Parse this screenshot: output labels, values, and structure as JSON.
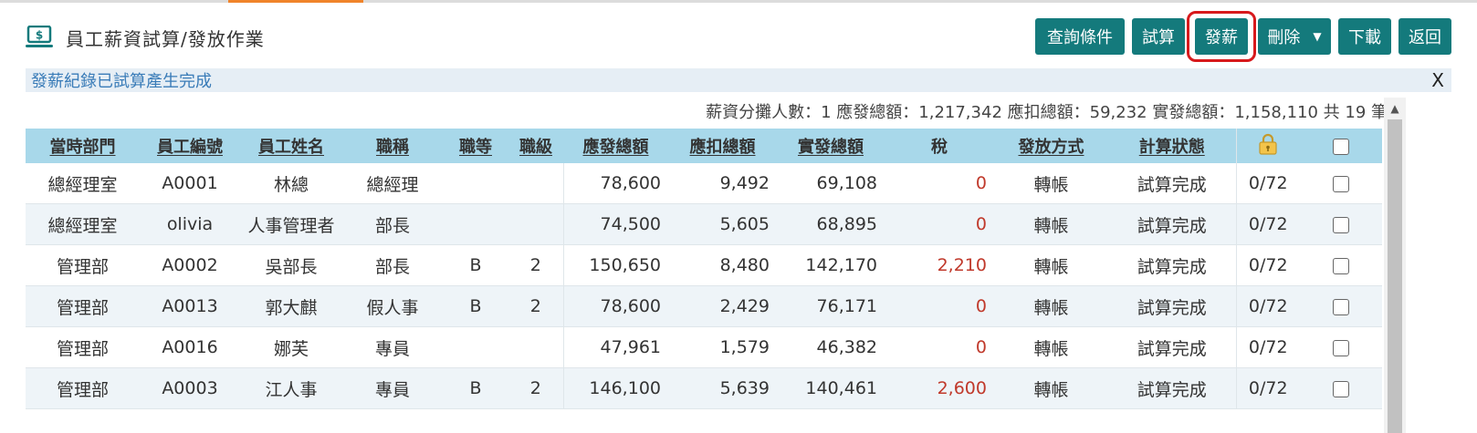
{
  "header": {
    "title": "員工薪資試算/發放作業",
    "icon": "dollar-screen-icon"
  },
  "toolbar": {
    "query_label": "查詢條件",
    "trial_label": "試算",
    "pay_label": "發薪",
    "delete_label": "刪除",
    "download_label": "下載",
    "back_label": "返回"
  },
  "alert": {
    "message": "發薪紀錄已試算產生完成",
    "close": "X"
  },
  "summary": {
    "text": "薪資分攤人數：1 應發總額：1,217,342 應扣總額：59,232 實發總額：1,158,110 共 19 筆"
  },
  "table": {
    "columns": [
      "當時部門",
      "員工編號",
      "員工姓名",
      "職稱",
      "職等",
      "職級",
      "應發總額",
      "應扣總額",
      "實發總額",
      "稅",
      "發放方式",
      "計算狀態",
      "",
      ""
    ],
    "rows": [
      {
        "dept": "總經理室",
        "id": "A0001",
        "name": "林總",
        "title": "總經理",
        "grade": "",
        "level": "",
        "gross": "78,600",
        "deduct": "9,492",
        "net": "69,108",
        "tax": "0",
        "method": "轉帳",
        "status": "試算完成",
        "lock": "0/72"
      },
      {
        "dept": "總經理室",
        "id": "olivia",
        "name": "人事管理者",
        "title": "部長",
        "grade": "",
        "level": "",
        "gross": "74,500",
        "deduct": "5,605",
        "net": "68,895",
        "tax": "0",
        "method": "轉帳",
        "status": "試算完成",
        "lock": "0/72"
      },
      {
        "dept": "管理部",
        "id": "A0002",
        "name": "吳部長",
        "title": "部長",
        "grade": "B",
        "level": "2",
        "gross": "150,650",
        "deduct": "8,480",
        "net": "142,170",
        "tax": "2,210",
        "method": "轉帳",
        "status": "試算完成",
        "lock": "0/72"
      },
      {
        "dept": "管理部",
        "id": "A0013",
        "name": "郭大麒",
        "title": "假人事",
        "grade": "B",
        "level": "2",
        "gross": "78,600",
        "deduct": "2,429",
        "net": "76,171",
        "tax": "0",
        "method": "轉帳",
        "status": "試算完成",
        "lock": "0/72"
      },
      {
        "dept": "管理部",
        "id": "A0016",
        "name": "娜芙",
        "title": "專員",
        "grade": "",
        "level": "",
        "gross": "47,961",
        "deduct": "1,579",
        "net": "46,382",
        "tax": "0",
        "method": "轉帳",
        "status": "試算完成",
        "lock": "0/72"
      },
      {
        "dept": "管理部",
        "id": "A0003",
        "name": "江人事",
        "title": "專員",
        "grade": "B",
        "level": "2",
        "gross": "146,100",
        "deduct": "5,639",
        "net": "140,461",
        "tax": "2,600",
        "method": "轉帳",
        "status": "試算完成",
        "lock": "0/72"
      }
    ]
  },
  "colors": {
    "accent": "#147a7c",
    "header_bg": "#a8d8ea",
    "tax_red": "#c0392b",
    "highlight": "#d7191c"
  }
}
